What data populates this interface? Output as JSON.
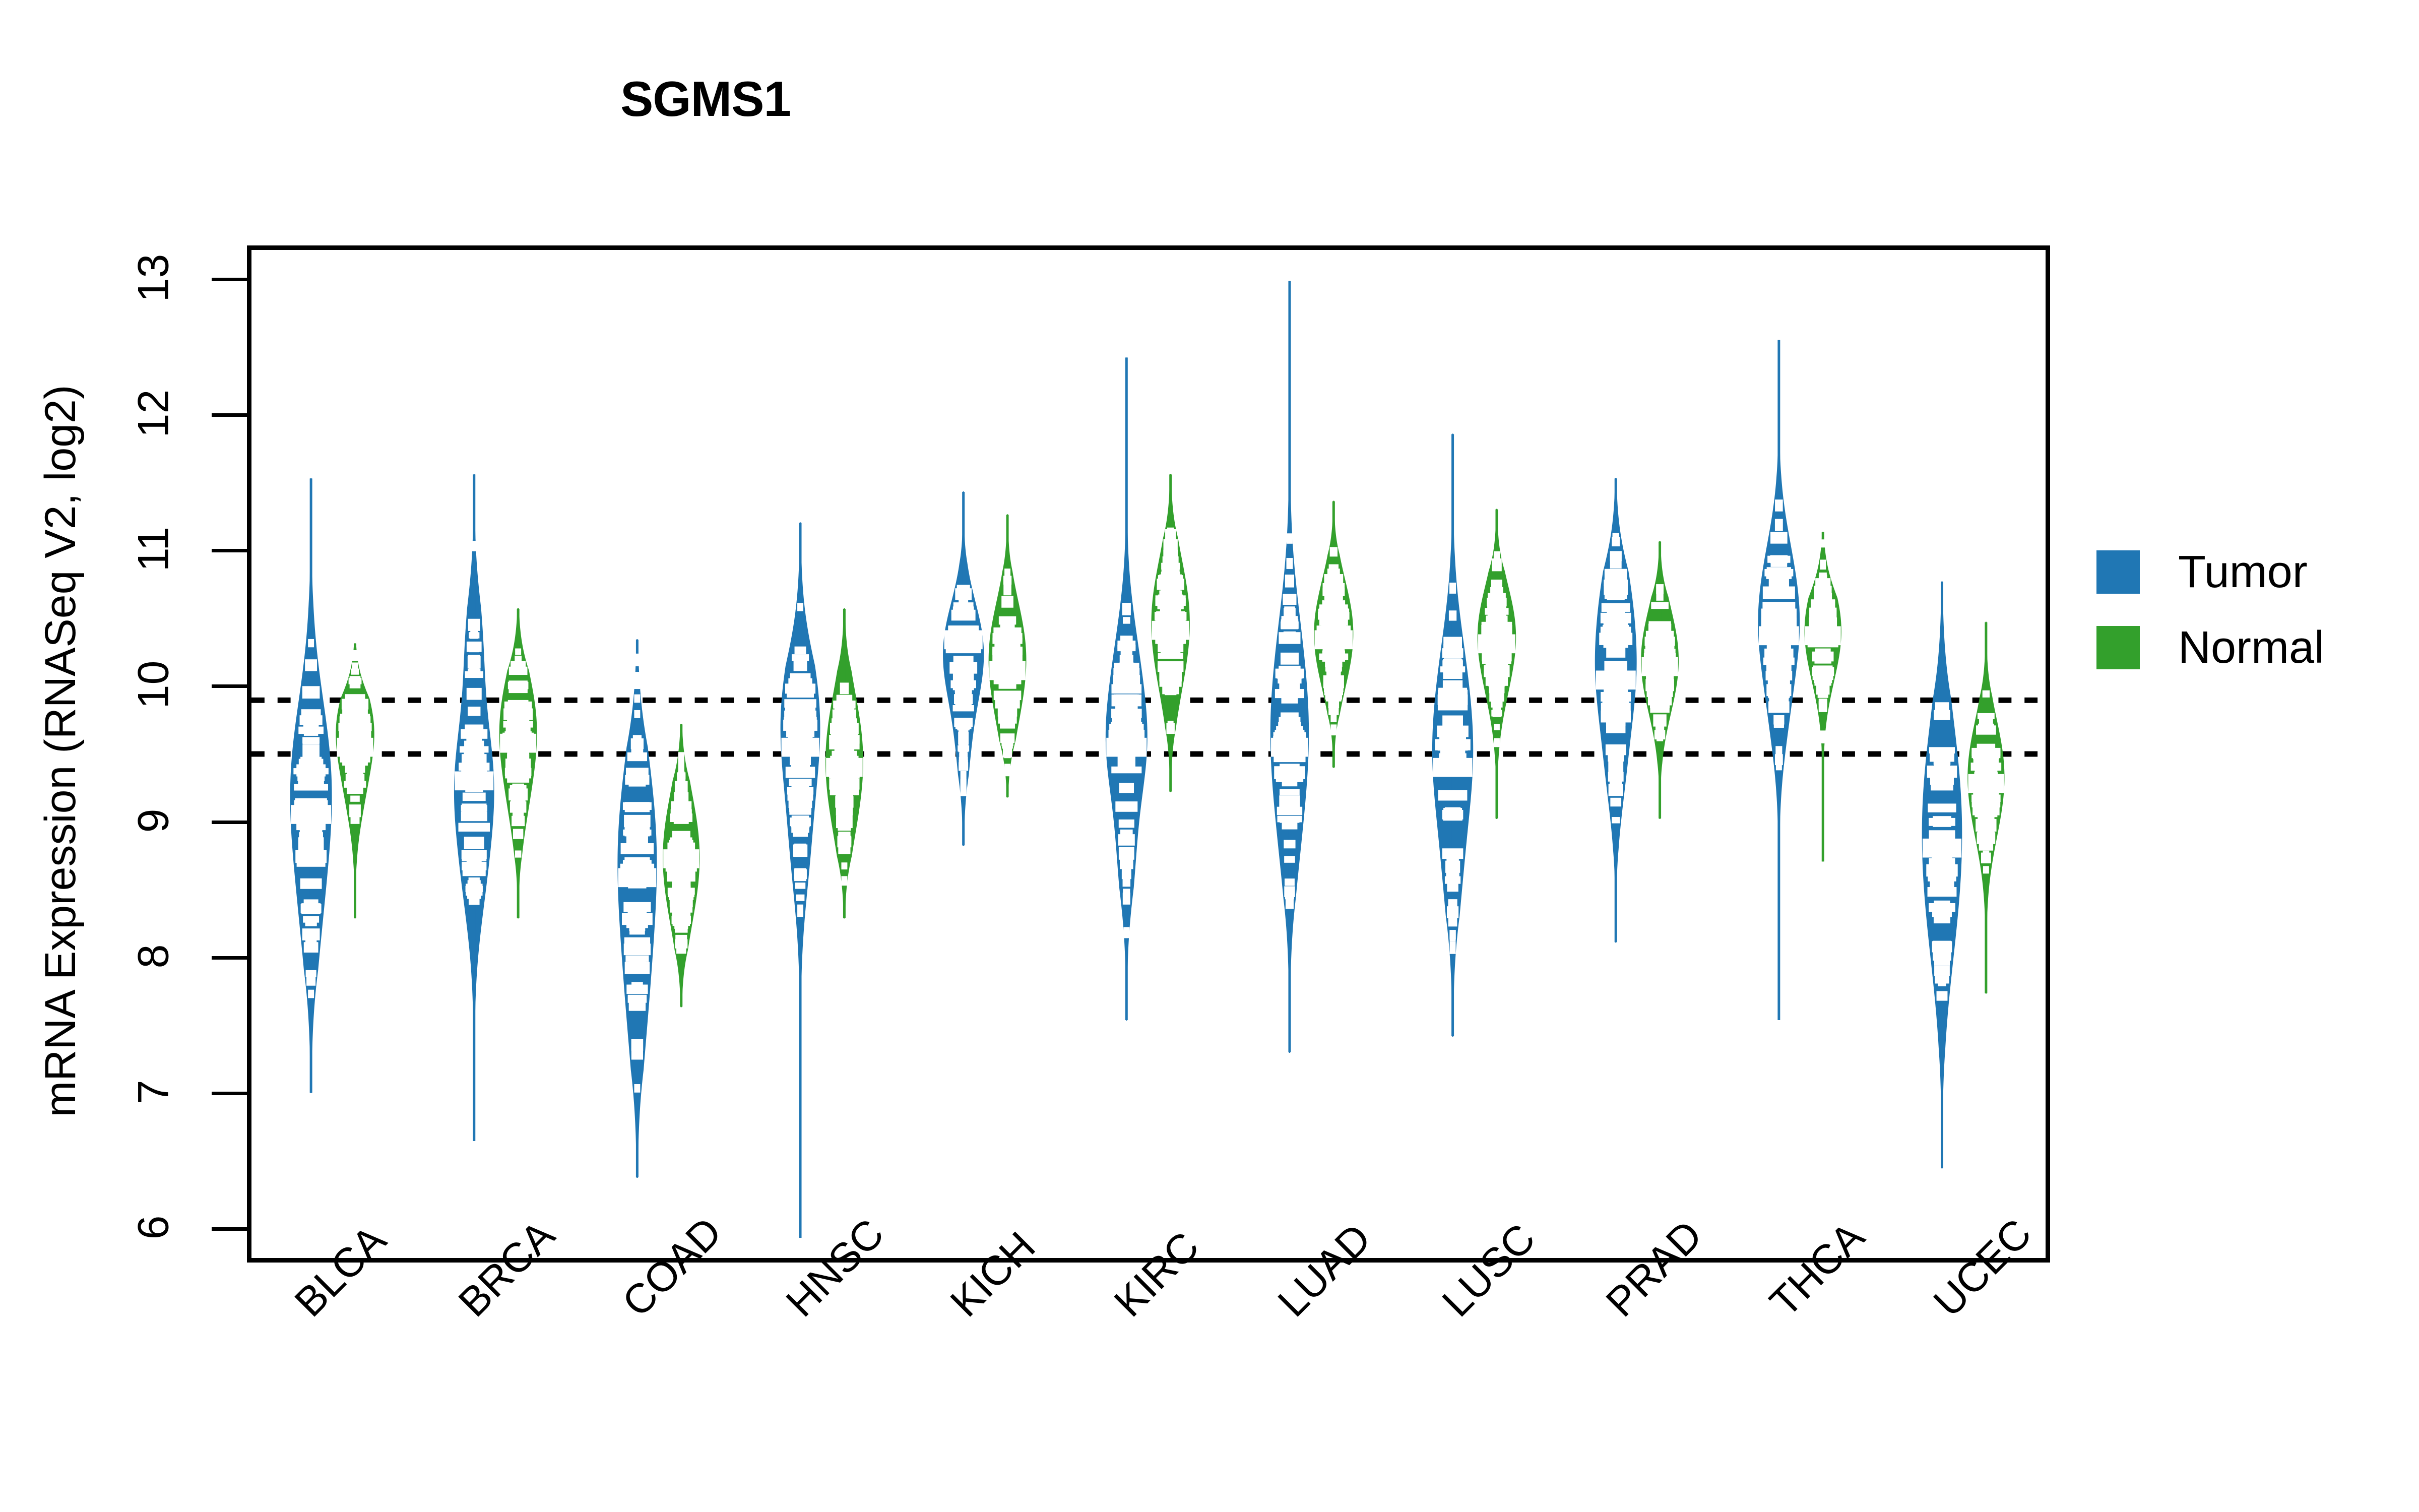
{
  "chart_data": {
    "type": "violin",
    "title": "SGMS1",
    "xlabel": "",
    "ylabel": "mRNA Expression (RNASeq V2, log2)",
    "ylim": [
      5.75,
      13.25
    ],
    "yticks": [
      6,
      7,
      8,
      9,
      10,
      11,
      12,
      13
    ],
    "ytick_labels": [
      "6",
      "7",
      "8",
      "9",
      "10",
      "11",
      "12",
      "13"
    ],
    "grid": false,
    "legend_position": "right",
    "reference_lines": [
      9.9,
      9.5
    ],
    "categories": [
      "BLCA",
      "BRCA",
      "COAD",
      "HNSC",
      "KICH",
      "KIRC",
      "LUAD",
      "LUSC",
      "PRAD",
      "THCA",
      "UCEC"
    ],
    "series": [
      {
        "name": "Tumor",
        "color": "#2077b4",
        "stats": [
          {
            "category": "BLCA",
            "median": 9.05,
            "q1": 8.55,
            "q3": 9.55,
            "min": 6.98,
            "max": 11.55,
            "width": 1.0,
            "peaks": [
              {
                "y": 9.1,
                "w": 1.0
              },
              {
                "y": 9.6,
                "w": 0.72
              },
              {
                "y": 8.3,
                "w": 0.6
              }
            ]
          },
          {
            "category": "BRCA",
            "median": 9.3,
            "q1": 8.9,
            "q3": 9.7,
            "min": 6.62,
            "max": 11.58,
            "width": 0.96,
            "peaks": [
              {
                "y": 9.32,
                "w": 0.96
              },
              {
                "y": 8.6,
                "w": 0.52
              },
              {
                "y": 10.3,
                "w": 0.45
              }
            ]
          },
          {
            "category": "COAD",
            "median": 8.58,
            "q1": 8.05,
            "q3": 9.1,
            "min": 6.35,
            "max": 10.35,
            "width": 0.94,
            "peaks": [
              {
                "y": 8.55,
                "w": 0.94
              },
              {
                "y": 9.2,
                "w": 0.7
              },
              {
                "y": 7.65,
                "w": 0.6
              }
            ]
          },
          {
            "category": "HNSC",
            "median": 9.55,
            "q1": 9.15,
            "q3": 9.95,
            "min": 5.9,
            "max": 11.22,
            "width": 0.95,
            "peaks": [
              {
                "y": 9.58,
                "w": 0.95
              },
              {
                "y": 10.1,
                "w": 0.62
              },
              {
                "y": 8.8,
                "w": 0.55
              }
            ]
          },
          {
            "category": "KICH",
            "median": 10.35,
            "q1": 10.05,
            "q3": 10.62,
            "min": 8.82,
            "max": 11.45,
            "width": 0.98,
            "peaks": [
              {
                "y": 10.4,
                "w": 0.98
              },
              {
                "y": 10.05,
                "w": 0.78
              },
              {
                "y": 9.5,
                "w": 0.35
              }
            ]
          },
          {
            "category": "KIRC",
            "median": 9.55,
            "q1": 9.2,
            "q3": 9.95,
            "min": 7.52,
            "max": 12.45,
            "width": 1.0,
            "peaks": [
              {
                "y": 9.55,
                "w": 1.0
              },
              {
                "y": 10.2,
                "w": 0.5
              },
              {
                "y": 8.7,
                "w": 0.4
              }
            ]
          },
          {
            "category": "LUAD",
            "median": 9.55,
            "q1": 9.15,
            "q3": 10.05,
            "min": 7.28,
            "max": 13.02,
            "width": 0.92,
            "peaks": [
              {
                "y": 9.6,
                "w": 0.92
              },
              {
                "y": 10.3,
                "w": 0.55
              },
              {
                "y": 8.85,
                "w": 0.48
              }
            ]
          },
          {
            "category": "LUSC",
            "median": 9.4,
            "q1": 9.0,
            "q3": 9.85,
            "min": 7.4,
            "max": 11.88,
            "width": 0.98,
            "peaks": [
              {
                "y": 9.42,
                "w": 0.98
              },
              {
                "y": 10.1,
                "w": 0.6
              },
              {
                "y": 8.6,
                "w": 0.45
              }
            ]
          },
          {
            "category": "PRAD",
            "median": 10.05,
            "q1": 9.7,
            "q3": 10.4,
            "min": 8.1,
            "max": 11.55,
            "width": 1.0,
            "peaks": [
              {
                "y": 10.08,
                "w": 1.0
              },
              {
                "y": 10.7,
                "w": 0.72
              },
              {
                "y": 9.4,
                "w": 0.5
              }
            ]
          },
          {
            "category": "THCA",
            "median": 10.38,
            "q1": 10.05,
            "q3": 10.72,
            "min": 7.52,
            "max": 12.58,
            "width": 1.0,
            "peaks": [
              {
                "y": 10.4,
                "w": 1.0
              },
              {
                "y": 10.9,
                "w": 0.62
              },
              {
                "y": 9.8,
                "w": 0.48
              }
            ]
          },
          {
            "category": "UCEC",
            "median": 8.8,
            "q1": 8.35,
            "q3": 9.4,
            "min": 6.42,
            "max": 10.78,
            "width": 0.96,
            "peaks": [
              {
                "y": 8.8,
                "w": 0.96
              },
              {
                "y": 9.45,
                "w": 0.85
              },
              {
                "y": 8.15,
                "w": 0.62
              }
            ]
          }
        ]
      },
      {
        "name": "Normal",
        "color": "#33a02c",
        "stats": [
          {
            "category": "BLCA",
            "median": 9.55,
            "q1": 9.32,
            "q3": 9.82,
            "min": 8.28,
            "max": 10.32,
            "width": 0.92,
            "peaks": [
              {
                "y": 9.6,
                "w": 0.92
              },
              {
                "y": 9.85,
                "w": 0.7
              },
              {
                "y": 9.2,
                "w": 0.55
              }
            ]
          },
          {
            "category": "BRCA",
            "median": 9.58,
            "q1": 9.3,
            "q3": 9.9,
            "min": 8.28,
            "max": 10.58,
            "width": 0.9,
            "peaks": [
              {
                "y": 9.6,
                "w": 0.9
              },
              {
                "y": 9.95,
                "w": 0.65
              },
              {
                "y": 9.15,
                "w": 0.52
              }
            ]
          },
          {
            "category": "COAD",
            "median": 8.72,
            "q1": 8.4,
            "q3": 9.05,
            "min": 7.62,
            "max": 9.72,
            "width": 0.88,
            "peaks": [
              {
                "y": 8.72,
                "w": 0.88
              },
              {
                "y": 9.05,
                "w": 0.62
              },
              {
                "y": 8.35,
                "w": 0.58
              }
            ]
          },
          {
            "category": "HNSC",
            "median": 9.4,
            "q1": 9.1,
            "q3": 9.75,
            "min": 8.28,
            "max": 10.58,
            "width": 0.9,
            "peaks": [
              {
                "y": 9.42,
                "w": 0.9
              },
              {
                "y": 9.8,
                "w": 0.62
              },
              {
                "y": 9.0,
                "w": 0.55
              }
            ]
          },
          {
            "category": "KICH",
            "median": 10.12,
            "q1": 9.88,
            "q3": 10.42,
            "min": 9.18,
            "max": 11.28,
            "width": 0.9,
            "peaks": [
              {
                "y": 10.15,
                "w": 0.9
              },
              {
                "y": 10.5,
                "w": 0.62
              },
              {
                "y": 9.75,
                "w": 0.48
              }
            ]
          },
          {
            "category": "KIRC",
            "median": 10.42,
            "q1": 10.08,
            "q3": 10.72,
            "min": 9.22,
            "max": 11.58,
            "width": 0.92,
            "peaks": [
              {
                "y": 10.45,
                "w": 0.92
              },
              {
                "y": 10.8,
                "w": 0.6
              },
              {
                "y": 10.05,
                "w": 0.52
              }
            ]
          },
          {
            "category": "LUAD",
            "median": 10.35,
            "q1": 10.12,
            "q3": 10.62,
            "min": 9.4,
            "max": 11.38,
            "width": 0.94,
            "peaks": [
              {
                "y": 10.38,
                "w": 0.94
              },
              {
                "y": 10.7,
                "w": 0.58
              },
              {
                "y": 10.05,
                "w": 0.52
              }
            ]
          },
          {
            "category": "LUSC",
            "median": 10.32,
            "q1": 10.05,
            "q3": 10.58,
            "min": 9.02,
            "max": 11.32,
            "width": 0.92,
            "peaks": [
              {
                "y": 10.35,
                "w": 0.92
              },
              {
                "y": 10.62,
                "w": 0.6
              },
              {
                "y": 10.0,
                "w": 0.52
              }
            ]
          },
          {
            "category": "PRAD",
            "median": 10.15,
            "q1": 9.92,
            "q3": 10.42,
            "min": 9.02,
            "max": 11.08,
            "width": 0.9,
            "peaks": [
              {
                "y": 10.18,
                "w": 0.9
              },
              {
                "y": 10.48,
                "w": 0.6
              },
              {
                "y": 9.88,
                "w": 0.52
              }
            ]
          },
          {
            "category": "THCA",
            "median": 10.38,
            "q1": 10.12,
            "q3": 10.62,
            "min": 8.7,
            "max": 11.15,
            "width": 0.88,
            "peaks": [
              {
                "y": 10.4,
                "w": 0.88
              },
              {
                "y": 10.65,
                "w": 0.58
              },
              {
                "y": 10.1,
                "w": 0.5
              }
            ]
          },
          {
            "category": "UCEC",
            "median": 9.28,
            "q1": 9.02,
            "q3": 9.58,
            "min": 7.72,
            "max": 10.48,
            "width": 0.88,
            "peaks": [
              {
                "y": 9.3,
                "w": 0.88
              },
              {
                "y": 9.62,
                "w": 0.6
              },
              {
                "y": 8.95,
                "w": 0.5
              }
            ]
          }
        ]
      }
    ]
  },
  "legend": {
    "items": [
      {
        "label": "Tumor",
        "color": "#2077b4"
      },
      {
        "label": "Normal",
        "color": "#33a02c"
      }
    ]
  }
}
